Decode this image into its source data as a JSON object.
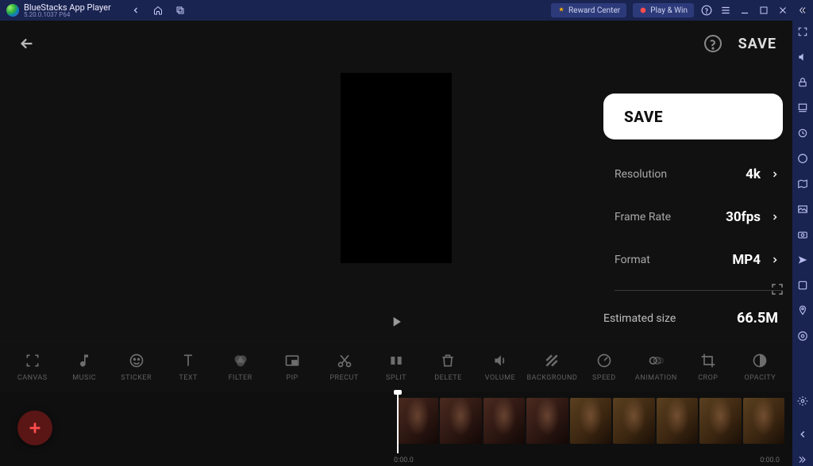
{
  "titlebar": {
    "app_name": "BlueStacks App Player",
    "subtitle": "5.20.0.1037 P64",
    "reward_label": "Reward Center",
    "play_label": "Play & Win"
  },
  "header": {
    "save_label": "SAVE"
  },
  "panel": {
    "save_button": "SAVE",
    "rows": [
      {
        "label": "Resolution",
        "value": "4k"
      },
      {
        "label": "Frame Rate",
        "value": "30fps"
      },
      {
        "label": "Format",
        "value": "MP4"
      }
    ],
    "estimated_label": "Estimated size",
    "estimated_value": "66.5M"
  },
  "toolbar": [
    {
      "id": "canvas",
      "label": "CANVAS",
      "icon": "canvas-icon"
    },
    {
      "id": "music",
      "label": "MUSIC",
      "icon": "music-icon"
    },
    {
      "id": "sticker",
      "label": "STICKER",
      "icon": "sticker-icon"
    },
    {
      "id": "text",
      "label": "TEXT",
      "icon": "text-icon"
    },
    {
      "id": "filter",
      "label": "FILTER",
      "icon": "filter-icon"
    },
    {
      "id": "pip",
      "label": "PIP",
      "icon": "pip-icon"
    },
    {
      "id": "precut",
      "label": "PRECUT",
      "icon": "precut-icon"
    },
    {
      "id": "split",
      "label": "SPLIT",
      "icon": "split-icon"
    },
    {
      "id": "delete",
      "label": "DELETE",
      "icon": "delete-icon"
    },
    {
      "id": "volume",
      "label": "VOLUME",
      "icon": "volume-icon"
    },
    {
      "id": "background",
      "label": "BACKGROUND",
      "icon": "background-icon"
    },
    {
      "id": "speed",
      "label": "SPEED",
      "icon": "speed-icon"
    },
    {
      "id": "animation",
      "label": "ANIMATION",
      "icon": "animation-icon"
    },
    {
      "id": "crop",
      "label": "CROP",
      "icon": "crop-icon"
    },
    {
      "id": "opacity",
      "label": "OPACITY",
      "icon": "opacity-icon"
    }
  ],
  "timeline": {
    "timecode_start": "0:00.0",
    "timecode_end": "0:00.0",
    "frame_count": 9
  },
  "sidebar_icons": [
    "expand-icon",
    "volume-icon",
    "lock-icon",
    "layers-icon",
    "target-icon",
    "clock-icon",
    "map-icon",
    "image-icon",
    "camera-icon",
    "plane-icon",
    "link-icon",
    "pin-icon",
    "aperture-icon",
    "gear-icon",
    "chevron-left-icon",
    "chevron-double-icon"
  ]
}
